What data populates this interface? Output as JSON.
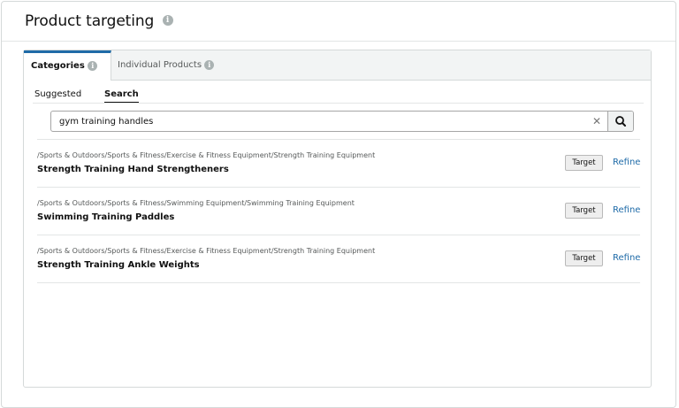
{
  "header": {
    "title": "Product targeting",
    "info_icon": "info-icon"
  },
  "tabs": [
    {
      "label": "Categories",
      "active": true
    },
    {
      "label": "Individual Products",
      "active": false
    }
  ],
  "subtabs": [
    {
      "label": "Suggested",
      "active": false
    },
    {
      "label": "Search",
      "active": true
    }
  ],
  "search": {
    "value": "gym training handles",
    "clear_icon": "close-icon",
    "button_icon": "search-icon"
  },
  "results": [
    {
      "path": "/Sports & Outdoors/Sports & Fitness/Exercise & Fitness Equipment/Strength Training Equipment",
      "title": "Strength Training Hand Strengtheners",
      "target_label": "Target",
      "refine_label": "Refine"
    },
    {
      "path": "/Sports & Outdoors/Sports & Fitness/Swimming Equipment/Swimming Training Equipment",
      "title": "Swimming Training Paddles",
      "target_label": "Target",
      "refine_label": "Refine"
    },
    {
      "path": "/Sports & Outdoors/Sports & Fitness/Exercise & Fitness Equipment/Strength Training Equipment",
      "title": "Strength Training Ankle Weights",
      "target_label": "Target",
      "refine_label": "Refine"
    }
  ],
  "colors": {
    "link": "#1f6ba8",
    "active_tab_border": "#1f6ba8"
  }
}
